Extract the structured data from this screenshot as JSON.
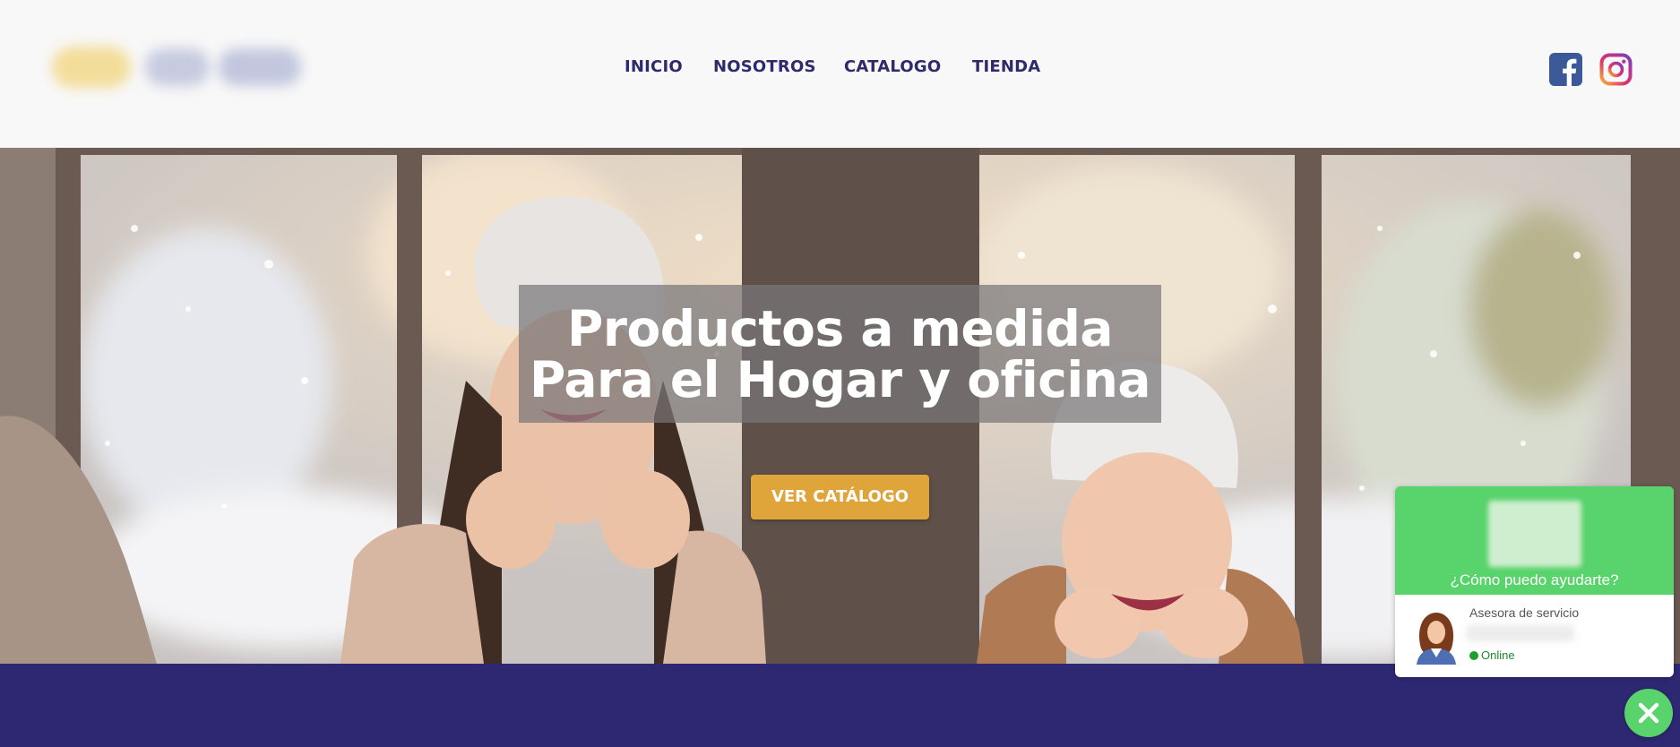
{
  "nav": {
    "items": [
      {
        "label": "INICIO"
      },
      {
        "label": "NOSOTROS"
      },
      {
        "label": "CATALOGO"
      },
      {
        "label": "TIENDA"
      }
    ]
  },
  "social": {
    "facebook_icon": "facebook-icon",
    "instagram_icon": "instagram-icon"
  },
  "hero": {
    "headline_line1": "Productos a medida",
    "headline_line2": "Para el Hogar y oficina",
    "cta_label": "VER CATÁLOGO"
  },
  "chat": {
    "title": "¿Cómo puedo ayudarte?",
    "agent_role": "Asesora de servicio",
    "status": "Online",
    "close_icon": "close-icon"
  },
  "colors": {
    "nav_text": "#2f2a6b",
    "cta": "#dfa53b",
    "band": "#2e2872",
    "chat_green": "#59d36b",
    "facebook": "#3b5998"
  }
}
